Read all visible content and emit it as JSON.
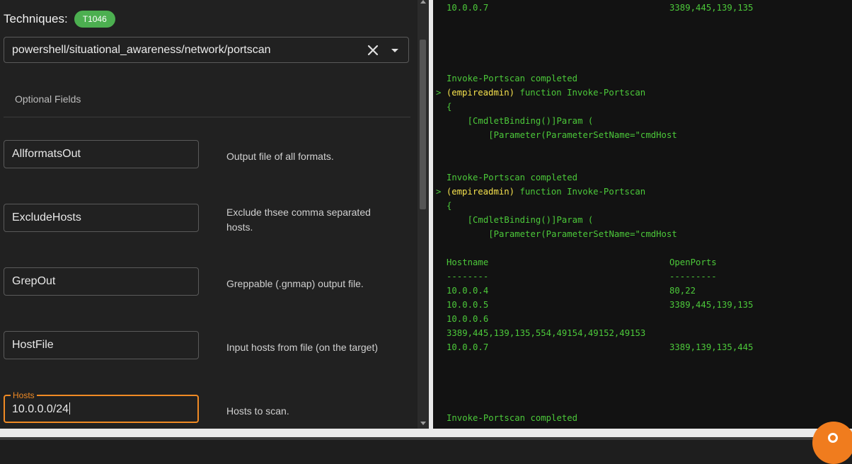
{
  "techniques": {
    "label": "Techniques:",
    "chip": "T1046"
  },
  "module": {
    "value": "powershell/situational_awareness/network/portscan"
  },
  "optional_section": {
    "title": "Optional Fields"
  },
  "fields": [
    {
      "name": "AllformatsOut",
      "description": "Output file of all formats."
    },
    {
      "name": "ExcludeHosts",
      "description": "Exclude thsee comma separated hosts."
    },
    {
      "name": "GrepOut",
      "description": "Greppable (.gnmap) output file."
    },
    {
      "name": "HostFile",
      "description": "Input hosts from file (on the target)"
    },
    {
      "name": "Hosts",
      "label": "Hosts",
      "value": "10.0.0.0/24",
      "description": "Hosts to scan."
    }
  ],
  "terminal": {
    "colors": {
      "output": "#4cc93a",
      "prompt_user": "#f4e04d"
    },
    "lines": {
      "l0_host": "10.0.0.7",
      "l0_ports": "3389,445,139,135",
      "completed1": "Invoke-Portscan completed",
      "prompt_sign": ">",
      "prompt_user": "(empireadmin)",
      "prompt_cmd": " function Invoke-Portscan",
      "brace": "{",
      "cmdlet": "    [CmdletBinding()]Param (",
      "param": "        [Parameter(ParameterSetName=\"cmdHost",
      "completed2": "Invoke-Portscan completed",
      "header_host": "Hostname",
      "header_ports": "OpenPorts",
      "dash_host": "--------",
      "dash_ports": "---------",
      "r1_host": "10.0.0.4",
      "r1_ports": "80,22",
      "r2_host": "10.0.0.5",
      "r2_ports": "3389,445,139,135",
      "r3_host": "10.0.0.6",
      "r3_ports": "3389,445,139,135,554,49154,49152,49153",
      "r4_host": "10.0.0.7",
      "r4_ports": "3389,139,135,445",
      "completed3": "Invoke-Portscan completed"
    }
  }
}
